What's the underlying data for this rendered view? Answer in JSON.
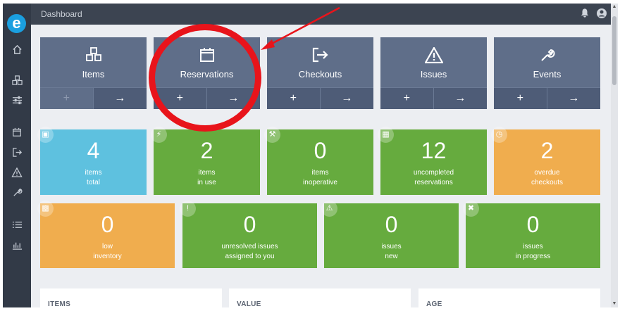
{
  "topbar": {
    "title": "Dashboard",
    "notifications_icon": "bell-icon",
    "account_icon": "user-circle-icon"
  },
  "sidebar": {
    "logo_letter": "e",
    "items": [
      "home-icon",
      "items-icon",
      "sliders-icon",
      "calendar-icon",
      "checkout-icon",
      "warning-icon",
      "wrench-icon",
      "list-icon",
      "chart-icon"
    ]
  },
  "modules": [
    {
      "label": "Items",
      "icon": "cubes-icon",
      "add": "+",
      "go": "→",
      "add_disabled": true
    },
    {
      "label": "Reservations",
      "icon": "calendar-icon",
      "add": "+",
      "go": "→"
    },
    {
      "label": "Checkouts",
      "icon": "sign-out-icon",
      "add": "+",
      "go": "→"
    },
    {
      "label": "Issues",
      "icon": "warning-icon",
      "add": "+",
      "go": "→"
    },
    {
      "label": "Events",
      "icon": "wrench-icon",
      "add": "+",
      "go": "→"
    }
  ],
  "stats_row1": [
    {
      "value": "4",
      "line1": "items",
      "line2": "total",
      "color": "#5ec1df",
      "icon": "cubes-icon"
    },
    {
      "value": "2",
      "line1": "items",
      "line2": "in use",
      "color": "#66ab3e",
      "icon": "bolt-icon"
    },
    {
      "value": "0",
      "line1": "items",
      "line2": "inoperative",
      "color": "#66ab3e",
      "icon": "wrench-icon"
    },
    {
      "value": "12",
      "line1": "uncompleted",
      "line2": "reservations",
      "color": "#66ab3e",
      "icon": "calendar-icon"
    },
    {
      "value": "2",
      "line1": "overdue",
      "line2": "checkouts",
      "color": "#f0ad4e",
      "icon": "clock-icon"
    }
  ],
  "stats_row2": [
    {
      "value": "0",
      "line1": "low",
      "line2": "inventory",
      "color": "#f0ad4e",
      "icon": "inventory-icon"
    },
    {
      "value": "0",
      "line1": "unresolved issues",
      "line2": "assigned to you",
      "color": "#66ab3e",
      "icon": "exclamation-circle-icon"
    },
    {
      "value": "0",
      "line1": "issues",
      "line2": "new",
      "color": "#66ab3e",
      "icon": "warning-icon"
    },
    {
      "value": "0",
      "line1": "issues",
      "line2": "in progress",
      "color": "#66ab3e",
      "icon": "tools-icon"
    }
  ],
  "panels": [
    {
      "title": "ITEMS"
    },
    {
      "title": "VALUE"
    },
    {
      "title": "AGE"
    }
  ],
  "annotation": {
    "color": "#e8141b",
    "target": "Reservations"
  }
}
